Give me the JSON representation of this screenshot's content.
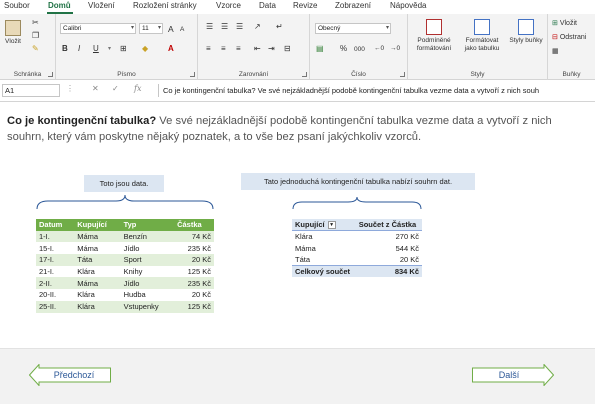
{
  "menu": {
    "tabs": [
      "Soubor",
      "Domů",
      "Vložení",
      "Rozložení stránky",
      "Vzorce",
      "Data",
      "Revize",
      "Zobrazení",
      "Nápověda"
    ],
    "active": "Domů"
  },
  "ribbon": {
    "clipboard": {
      "paste_label": "Vložit",
      "group_label": "Schránka"
    },
    "font": {
      "font_name": "Calibri",
      "font_size": "11",
      "bold": "B",
      "italic": "I",
      "underline": "U",
      "grow": "A",
      "shrink": "A",
      "group_label": "Písmo"
    },
    "alignment": {
      "group_label": "Zarovnání"
    },
    "number": {
      "format": "Obecný",
      "percent": "%",
      "thousands": "000",
      "group_label": "Číslo"
    },
    "styles": {
      "conditional_label": "Podmíněné formátování",
      "format_table_label": "Formátovat jako tabulku",
      "cell_styles_label": "Styly buňky",
      "group_label": "Styly"
    },
    "cells": {
      "insert_label": "Vložit",
      "delete_label": "Odstrani",
      "group_label": "Buňky"
    }
  },
  "formula_bar": {
    "name_box": "A1",
    "cancel": "✕",
    "confirm": "✓",
    "fx": "fx",
    "formula": "Co je kontingenční tabulka? Ve své nejzákladnější podobě kontingenční tabulka vezme data a vytvoří z nich souh"
  },
  "intro": {
    "title": "Co je kontingenční tabulka?",
    "body": " Ve své nejzákladnější podobě kontingenční tabulka vezme data a vytvoří z nich souhrn, který vám poskytne nějaký poznatek, a to vše bez psaní jakýchkoliv vzorců."
  },
  "callouts": {
    "data": "Toto jsou data.",
    "pivot": "Tato jednoduchá kontingenční tabulka nabízí souhrn dat."
  },
  "data_table": {
    "headers": [
      "Datum",
      "Kupující",
      "Typ",
      "Částka"
    ],
    "rows": [
      [
        "1-I.",
        "Máma",
        "Benzín",
        "74 Kč"
      ],
      [
        "15-I.",
        "Máma",
        "Jídlo",
        "235 Kč"
      ],
      [
        "17-I.",
        "Táta",
        "Sport",
        "20 Kč"
      ],
      [
        "21-I.",
        "Klára",
        "Knihy",
        "125 Kč"
      ],
      [
        "2-II.",
        "Máma",
        "Jídlo",
        "235 Kč"
      ],
      [
        "20-II.",
        "Klára",
        "Hudba",
        "20 Kč"
      ],
      [
        "25-II.",
        "Klára",
        "Vstupenky",
        "125 Kč"
      ]
    ]
  },
  "pivot_table": {
    "headers": [
      "Kupující",
      "Součet z Částka"
    ],
    "rows": [
      [
        "Klára",
        "270 Kč"
      ],
      [
        "Máma",
        "544 Kč"
      ],
      [
        "Táta",
        "20 Kč"
      ]
    ],
    "total": [
      "Celkový součet",
      "834 Kč"
    ]
  },
  "navigation": {
    "prev_label": "Předchozí",
    "next_label": "Další"
  },
  "colors": {
    "excel_green": "#217346",
    "table_header": "#70ad47",
    "table_band": "#e2efda",
    "callout_bg": "#dce6f2",
    "nav_green": "#70ad47"
  }
}
